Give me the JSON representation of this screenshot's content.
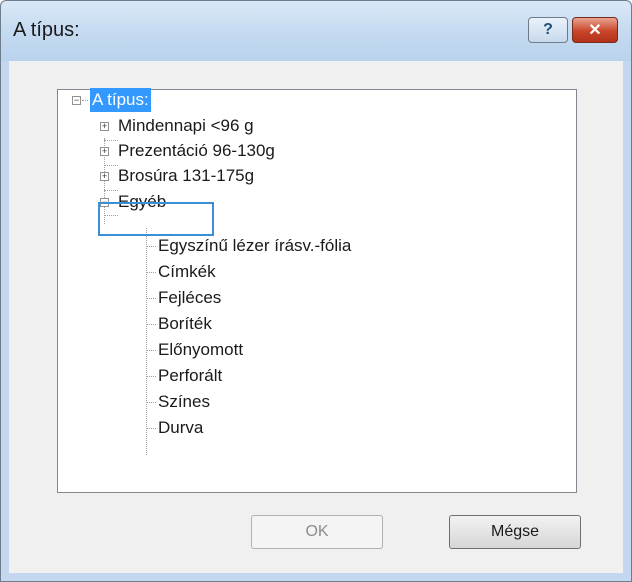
{
  "window": {
    "title": "A típus:",
    "help_label": "?",
    "close_label": "✕"
  },
  "tree": {
    "root": {
      "label": "A típus:",
      "expander": "−",
      "selected": true
    },
    "categories": [
      {
        "label": "Mindennapi <96 g",
        "expander": "+"
      },
      {
        "label": "Prezentáció 96-130g",
        "expander": "+"
      },
      {
        "label": "Brosúra 131-175g",
        "expander": "+"
      },
      {
        "label": "Egyéb",
        "expander": "−",
        "focused": true
      }
    ],
    "other_children": [
      "Egyszínű lézer írásv.-fólia",
      "Címkék",
      "Fejléces",
      "Boríték",
      "Előnyomott",
      "Perforált",
      "Színes",
      "Durva"
    ]
  },
  "buttons": {
    "ok_label": "OK",
    "ok_enabled": false,
    "cancel_label": "Mégse"
  },
  "colors": {
    "titlebar": "#c5dbf1",
    "selection": "#3399ff",
    "focus_border": "#3a8fd6",
    "close_button": "#c9452a"
  }
}
